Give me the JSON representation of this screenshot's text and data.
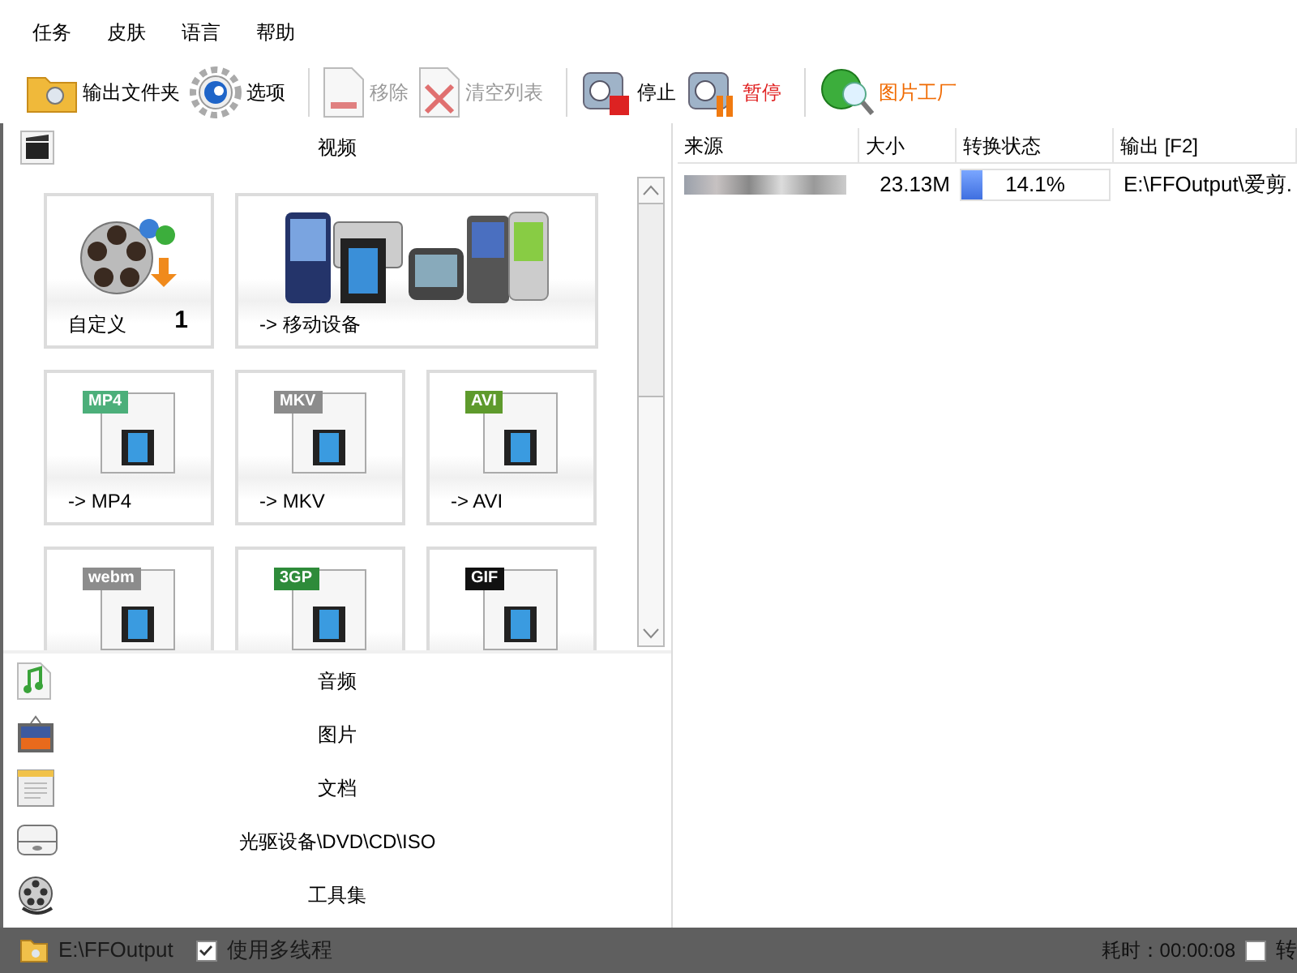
{
  "menu": [
    "任务",
    "皮肤",
    "语言",
    "帮助"
  ],
  "toolbar": [
    {
      "label": "输出文件夹",
      "kind": "normal"
    },
    {
      "label": "选项",
      "kind": "normal"
    },
    {
      "label": "移除",
      "kind": "disabled"
    },
    {
      "label": "清空列表",
      "kind": "disabled"
    },
    {
      "label": "停止",
      "kind": "normal"
    },
    {
      "label": "暂停",
      "kind": "alert"
    },
    {
      "label": "图片工厂",
      "kind": "accent"
    }
  ],
  "video_section": {
    "title": "视频"
  },
  "tiles": [
    {
      "kind": "custom",
      "label": "自定义",
      "count": "1"
    },
    {
      "kind": "devices",
      "label": "-> 移动设备"
    },
    {
      "kind": "file",
      "badge": "MP4",
      "color": "#4caf7a",
      "label": "-> MP4"
    },
    {
      "kind": "file",
      "badge": "MKV",
      "color": "#8c8c8c",
      "label": "-> MKV"
    },
    {
      "kind": "file",
      "badge": "AVI",
      "color": "#5e9a2c",
      "label": "-> AVI"
    },
    {
      "kind": "file",
      "badge": "webm",
      "color": "#8c8c8c"
    },
    {
      "kind": "file",
      "badge": "3GP",
      "color": "#2e8b3a"
    },
    {
      "kind": "file",
      "badge": "GIF",
      "color": "#111111"
    }
  ],
  "categories": [
    {
      "label": "音频"
    },
    {
      "label": "图片"
    },
    {
      "label": "文档"
    },
    {
      "label": "光驱设备\\DVD\\CD\\ISO"
    },
    {
      "label": "工具集"
    }
  ],
  "table": {
    "columns": [
      "来源",
      "大小",
      "转换状态",
      "输出 [F2]"
    ],
    "rows": [
      {
        "size": "23.13M",
        "level": 0.141,
        "progress": "14.1%",
        "output": "E:\\FFOutput\\爱剪."
      }
    ]
  },
  "status_bar": {
    "folder": "E:\\FFOutput",
    "multithread": {
      "label": "使用多线程",
      "checked": true
    },
    "elapsed": "耗时：00:00:08",
    "option": {
      "label": "转",
      "checked": false
    }
  }
}
